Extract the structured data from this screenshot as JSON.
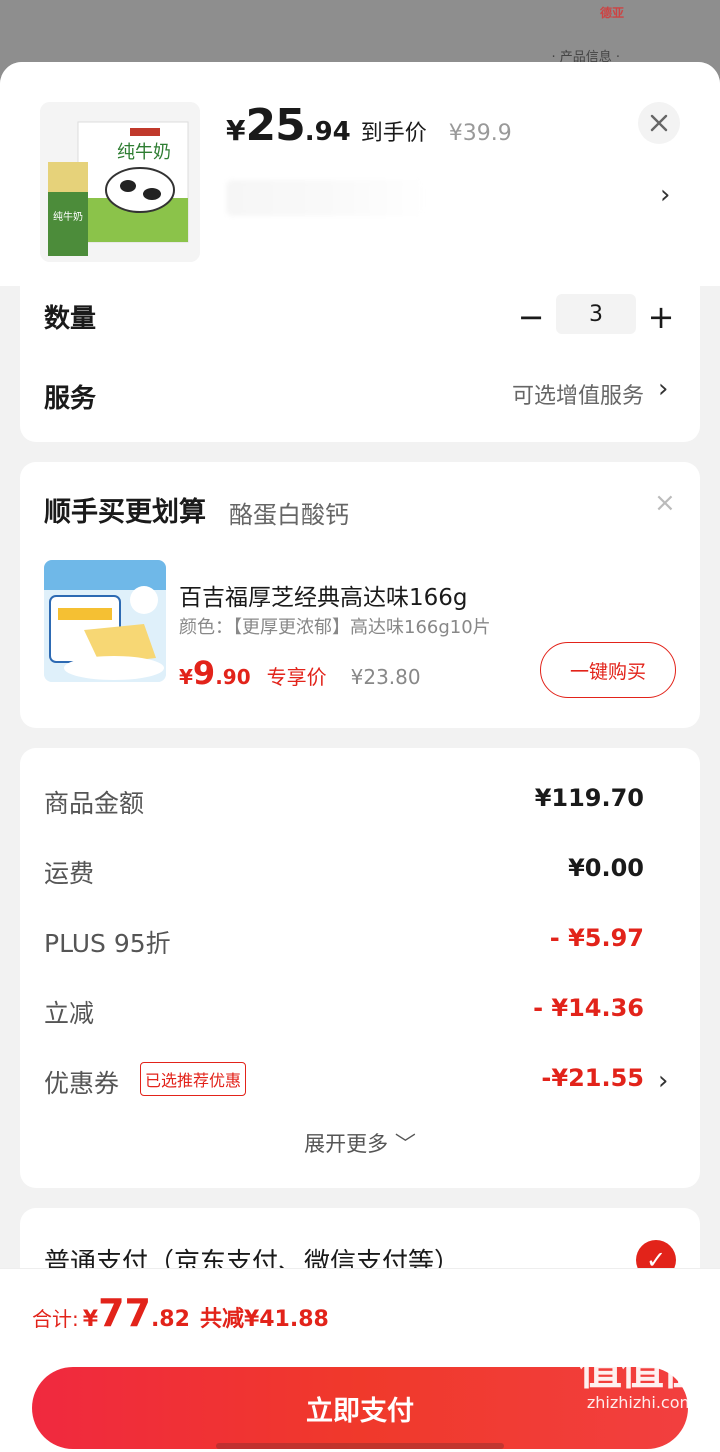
{
  "backdrop": {
    "brand": "德亚",
    "info": "· 产品信息 ·"
  },
  "product": {
    "price_yen": "¥",
    "price_int": "25",
    "price_dec": ".94",
    "price_label": "到手价",
    "original_price": "¥39.9",
    "spec_chevron": "›"
  },
  "quantity": {
    "label": "数量",
    "value": "3",
    "minus": "−",
    "plus": "+"
  },
  "service": {
    "label": "服务",
    "value": "可选增值服务",
    "chevron": "›"
  },
  "bundle": {
    "title": "顺手买更划算",
    "subtitle": "酪蛋白酸钙",
    "close": "×",
    "item": {
      "name": "百吉福厚芝经典高达味166g",
      "spec": "颜色：【更厚更浓郁】高达味166g10片",
      "price_yen": "¥",
      "price_int": "9",
      "price_dec": ".90",
      "price_label": "专享价",
      "original_price": "¥23.80",
      "buy_label": "一键购买"
    }
  },
  "fees": {
    "goods": {
      "label": "商品金额",
      "value": "¥119.70"
    },
    "shipping": {
      "label": "运费",
      "value": "¥0.00"
    },
    "plus": {
      "label": "PLUS 95折",
      "value": "- ¥5.97"
    },
    "instant": {
      "label": "立减",
      "value": "- ¥14.36"
    },
    "coupon": {
      "label": "优惠券",
      "badge": "已选推荐优惠",
      "value": "-¥21.55",
      "chevron": "›"
    },
    "expand_label": "展开更多 ﹀"
  },
  "payment": {
    "method": "普通支付（京东支付、微信支付等）",
    "check": "✓"
  },
  "total": {
    "label": "合计:",
    "yen": "¥",
    "int": "77",
    "dec": ".82",
    "savings": "共减¥41.88",
    "pay_label": "立即支付"
  },
  "watermark": {
    "text": "值值值",
    "url": "zhizhizhi.com"
  },
  "colors": {
    "accent": "#e2231a",
    "button": "#f0293f"
  }
}
